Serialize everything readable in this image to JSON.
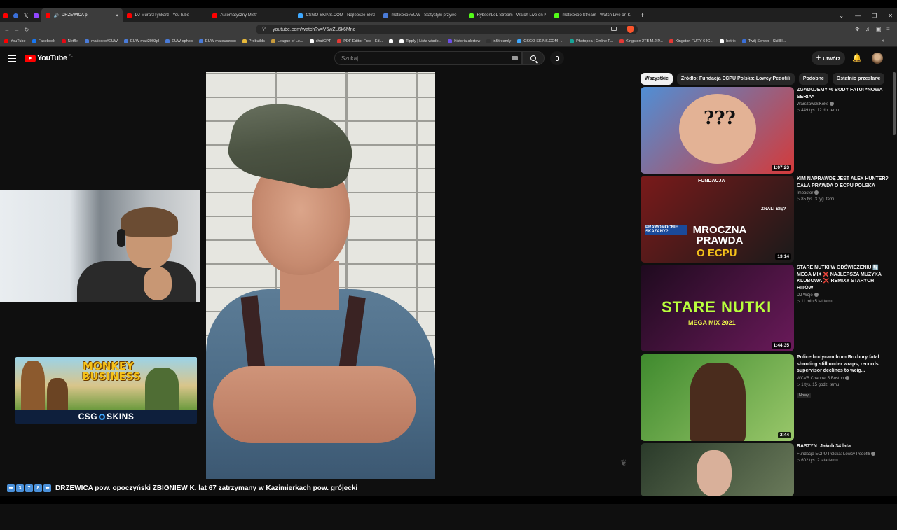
{
  "browser": {
    "tabs": [
      {
        "title": "DRZEWICA p",
        "active": true,
        "color": "#ff0000"
      },
      {
        "title": "DJ MurarzTynkarz - YouTube",
        "active": false,
        "color": "#ff0000"
      },
      {
        "title": "Automatyczny Mistr",
        "active": false,
        "color": "#ff0000"
      },
      {
        "title": "CSGO-SKINS.COM - Najlepsze Skrzy",
        "active": false,
        "color": "#3ea8ff"
      },
      {
        "title": "matixoxo#EUW - Statystyki przywo",
        "active": false,
        "color": "#4a7bd8"
      },
      {
        "title": "RybsonLoL Stream - Watch Live on K",
        "active": false,
        "color": "#53fc18"
      },
      {
        "title": "matixoxoo Stream - Watch Live on K",
        "active": false,
        "color": "#53fc18"
      }
    ],
    "new_tab": "+",
    "address": "youtube.com/watch?v=V6wZL6k6Mnc",
    "bookmarks": [
      {
        "label": "YouTube",
        "color": "#ff0000"
      },
      {
        "label": "Facebook",
        "color": "#1877f2"
      },
      {
        "label": "Netflix",
        "color": "#e50914"
      },
      {
        "label": "matixoxo#EUW",
        "color": "#4a7bd8"
      },
      {
        "label": "EUW mati2003pl",
        "color": "#4a7bd8"
      },
      {
        "label": "EUW ophob",
        "color": "#4a7bd8"
      },
      {
        "label": "EUW mateuszoxo",
        "color": "#4a7bd8"
      },
      {
        "label": "Probuilds",
        "color": "#e8b93a"
      },
      {
        "label": "League of Le...",
        "color": "#c89b3c"
      },
      {
        "label": "chatGPT",
        "color": "#ffffff"
      },
      {
        "label": "PDF Editor Free - Ed...",
        "color": "#e53935"
      },
      {
        "label": "",
        "color": "#ffffff"
      },
      {
        "label": "Tipply | Lista wiado...",
        "color": "#ffffff"
      },
      {
        "label": "historia alertow",
        "color": "#6c4ee8"
      },
      {
        "label": "inStreamly",
        "color": "#333333"
      },
      {
        "label": "CSGO-SKINS.COM -...",
        "color": "#3ea8ff"
      },
      {
        "label": "Photopea | Online P...",
        "color": "#18a497"
      },
      {
        "label": "Kingston 2TB M.2 P...",
        "color": "#e53935"
      },
      {
        "label": "Kingston FURY 64G...",
        "color": "#e53935"
      },
      {
        "label": "botrix",
        "color": "#ffffff"
      },
      {
        "label": "Twój Serwer - SkillH...",
        "color": "#3a6fd8"
      }
    ]
  },
  "youtube": {
    "logo": "YouTube",
    "logo_region": "PL",
    "search_placeholder": "Szukaj",
    "create_label": "Utwórz"
  },
  "chips": [
    "Wszystkie",
    "Źródło: Fundacja ECPU Polska: Łowcy Pedofili",
    "Podobne",
    "Ostatnio przesłane"
  ],
  "ad": {
    "title": "MONKEY BUSINESS",
    "brand_left": "CSG",
    "brand_right": "SKINS"
  },
  "recommendations": [
    {
      "title": "ZGADUJEMY % BODY FATU! *NOWA SERIA*",
      "channel": "WarszawskiKoks",
      "views": "449 tys.",
      "age": "12 dni temu",
      "duration": "1:07:23",
      "thumb_colors": [
        "#4f8fd6",
        "#d43a3a"
      ]
    },
    {
      "title": "KIM NAPRAWDĘ JEST ALEX HUNTER? CAŁA PRAWDA O ECPU POLSKA",
      "channel": "Impostor",
      "views": "85 tys.",
      "age": "3 tyg. temu",
      "duration": "13:14",
      "thumb_colors": [
        "#7a1a1a",
        "#1a1a1a"
      ]
    },
    {
      "title": "STARE NUTKI W ODŚWIEŻENIU 🔄 MEGA MIX ❌ NAJLEPSZA MUZYKA KLUBOWA ❌ REMIXY STARYCH HITÓW",
      "channel": "DJ Wójo",
      "views": "11 mln",
      "age": "5 lat temu",
      "duration": "1:44:35",
      "thumb_colors": [
        "#1e0a1e",
        "#6a1a5a"
      ]
    },
    {
      "title": "Police bodycam from Roxbury fatal shooting still under wraps, records supervisor declines to weig...",
      "channel": "WCVB Channel 5 Boston",
      "views": "1 tys.",
      "age": "15 godz. temu",
      "duration": "2:44",
      "badge": "Nowy",
      "thumb_colors": [
        "#3f8a2e",
        "#99c76a"
      ]
    },
    {
      "title": "RASZYN: Jakub 34 lata",
      "channel": "Fundacja ECPU Polska: Łowcy Pedofili",
      "views": "602 tys.",
      "age": "2 lata temu",
      "duration": "",
      "thumb_colors": [
        "#2a3a2a",
        "#6a7a5a"
      ]
    }
  ],
  "ad_text": {
    "stare": "STARE NUTKI",
    "mega": "MEGA MIX 2021",
    "mroczna": "MROCZNA PRAWDA",
    "ecpu": "O ECPU",
    "fundacja": "FUNDACJA",
    "prawomocnie": "PRAWOMOCNIE SKAZANY?!",
    "znali": "ZNALI SIĘ?",
    "percent": "???"
  },
  "caption": {
    "keycaps": [
      "➡",
      "3",
      "7",
      "8",
      "⬅"
    ],
    "text": "DRZEWICA pow. opoczyński ZBIGNIEW K. lat 67 zatrzymany w Kazimierkach pow. grójecki"
  }
}
